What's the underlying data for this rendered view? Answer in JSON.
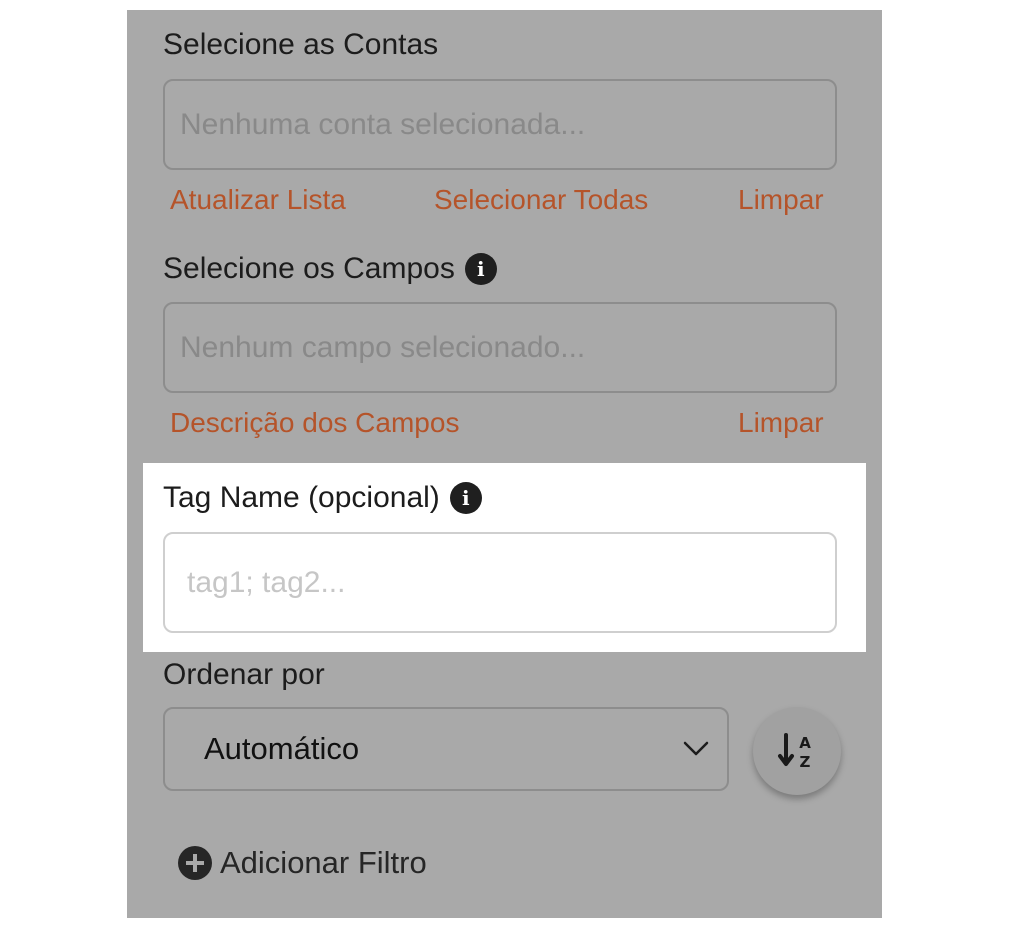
{
  "accounts": {
    "label": "Selecione as Contas",
    "placeholder": "Nenhuma conta selecionada...",
    "actions": {
      "refresh": "Atualizar Lista",
      "select_all": "Selecionar Todas",
      "clear": "Limpar"
    }
  },
  "fields": {
    "label": "Selecione os Campos",
    "info_icon": "i",
    "placeholder": "Nenhum campo selecionado...",
    "actions": {
      "description": "Descrição dos Campos",
      "clear": "Limpar"
    }
  },
  "tag": {
    "label": "Tag Name (opcional)",
    "info_icon": "i",
    "placeholder": "tag1; tag2...",
    "value": ""
  },
  "sort": {
    "label": "Ordenar por",
    "selected": "Automático",
    "button_icon": "sort-alpha-down-icon",
    "glyph_top": "A",
    "glyph_bottom": "Z"
  },
  "filter": {
    "add_label": "Adicionar Filtro",
    "icon": "plus-circle-icon"
  },
  "colors": {
    "panel": "#a9a9a9",
    "highlight": "#ffffff",
    "link": "#b5542a",
    "text": "#1c1c1c",
    "placeholder": "#898989"
  }
}
